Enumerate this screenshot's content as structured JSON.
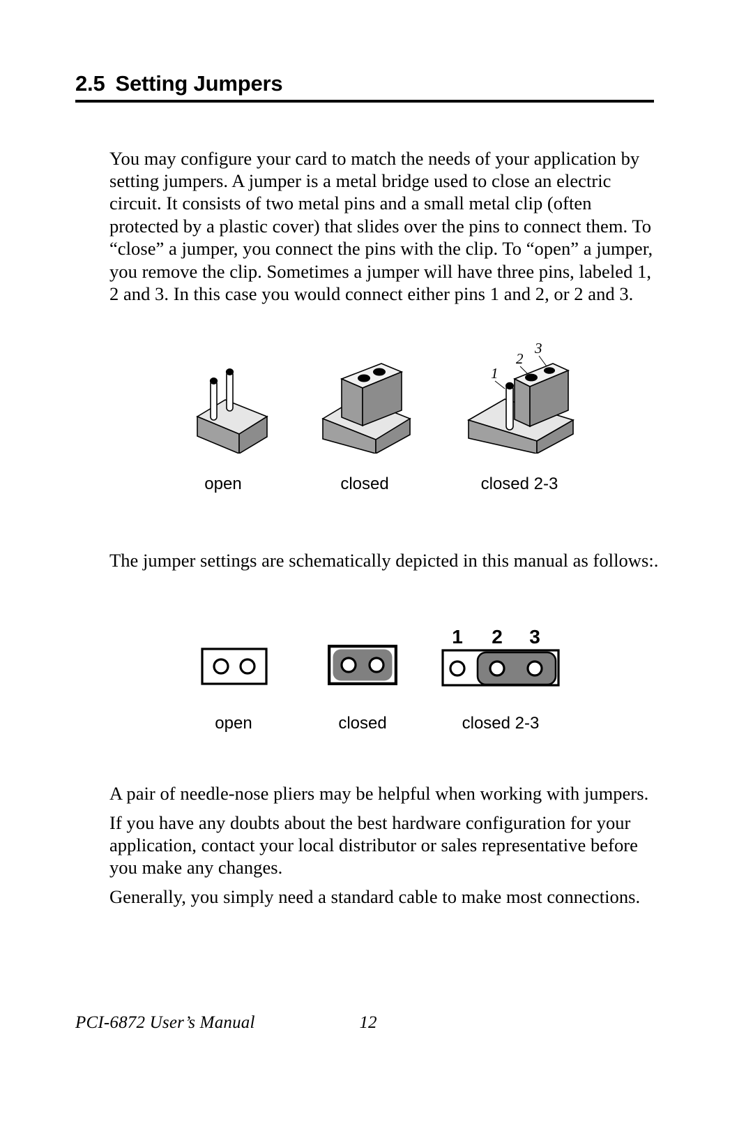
{
  "heading": {
    "number": "2.5",
    "title": "Setting Jumpers"
  },
  "body": {
    "intro": "You may configure your card to match the needs of your application by setting jumpers. A jumper is a metal bridge used to close an  electric circuit. It consists of two metal pins and a small metal clip (often protected by a plastic cover) that slides over the pins to connect them. To “close” a jumper, you connect the pins with the clip. To “open” a jumper, you remove the clip. Sometimes a jumper will have three pins, labeled 1, 2 and 3. In this case you would connect either pins 1 and 2, or 2 and 3.",
    "schematic_intro": "The jumper settings are schematically depicted in this manual as follows:.",
    "pliers": "A pair of needle-nose pliers may be helpful when working with jumpers.",
    "doubts": "If you have any doubts about the best hardware configuration for your application, contact your local distributor or sales representative before you make any changes.",
    "cable": "Generally, you simply need a standard cable to make most connections."
  },
  "figure_3d": {
    "captions": {
      "open": "open",
      "closed": "closed",
      "closed_2_3": "closed 2-3"
    },
    "pin_labels": {
      "one": "1",
      "two": "2",
      "three": "3"
    }
  },
  "figure_schematic": {
    "captions": {
      "open": "open",
      "closed": "closed",
      "closed_2_3": "closed 2-3"
    },
    "pin_labels": {
      "one": "1",
      "two": "2",
      "three": "3"
    }
  },
  "footer": {
    "manual": "PCI-6872 User’s Manual",
    "page_number": "12"
  },
  "colors": {
    "ink": "#000000",
    "paper": "#ffffff",
    "block_top": "#e3e3e3",
    "block_front": "#8f8f8f",
    "block_side": "#a8a8a8",
    "cap_top": "#efefef",
    "cap_front": "#9a9a9a",
    "cap_side": "#b4b4b4",
    "clip_gray": "#808080"
  }
}
